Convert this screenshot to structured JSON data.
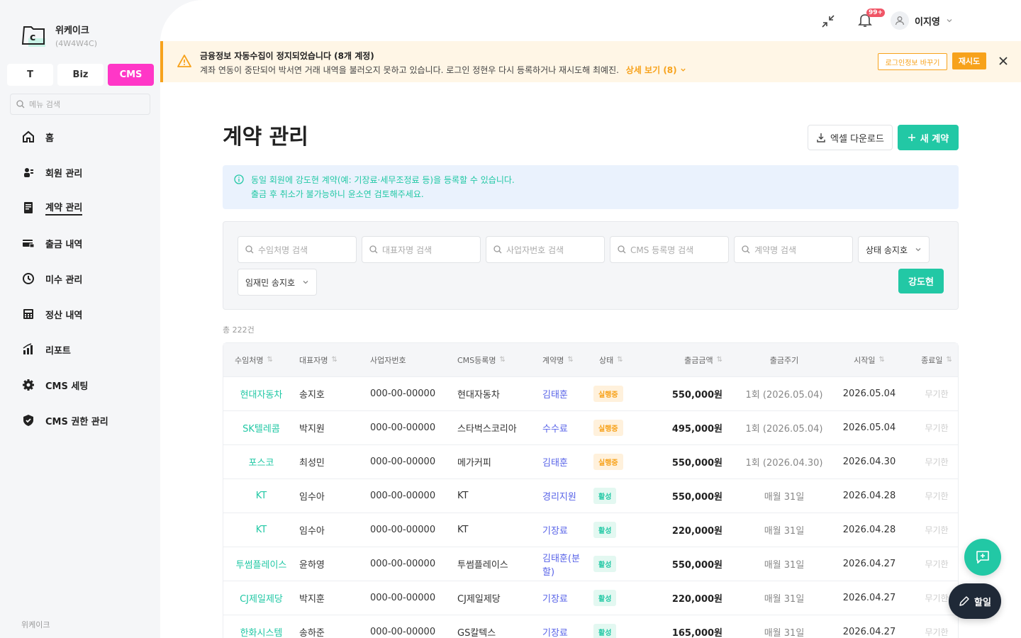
{
  "company": {
    "name": "위케이크",
    "code": "(4W4W4C)"
  },
  "mode_tabs": [
    {
      "label": "T",
      "active": false
    },
    {
      "label": "Biz",
      "active": false
    },
    {
      "label": "CMS",
      "active": true
    }
  ],
  "menu_search": {
    "placeholder": "메뉴 검색"
  },
  "menu": [
    {
      "label": "홈",
      "icon": "home-icon"
    },
    {
      "label": "회원 관리",
      "icon": "members-icon"
    },
    {
      "label": "계약 관리",
      "icon": "contract-icon",
      "active": true
    },
    {
      "label": "출금 내역",
      "icon": "withdrawal-icon"
    },
    {
      "label": "미수 관리",
      "icon": "clock-icon"
    },
    {
      "label": "정산 내역",
      "icon": "calculator-icon"
    },
    {
      "label": "리포트",
      "icon": "chart-icon"
    },
    {
      "label": "CMS 세팅",
      "icon": "gear-icon"
    },
    {
      "label": "CMS 권한 관리",
      "icon": "shield-icon"
    }
  ],
  "footer_brand": "위케이크",
  "topbar": {
    "notification_count": "99+",
    "user_name": "이지영"
  },
  "alert": {
    "title": "금융정보 자동수집이 정지되었습니다 (8개 계정)",
    "body": "계좌 연동이 중단되어 박서연 거래 내역을 불러오지 못하고 있습니다. 로그인 정현우 다시 등록하거나 재시도해 최예진.",
    "more": "상세 보기 (8)",
    "btn_update": "로그인정보 바꾸기",
    "btn_retry": "재시도"
  },
  "page": {
    "title": "계약 관리",
    "excel_btn": "엑셀 다운로드",
    "new_btn": "새 계약"
  },
  "info": {
    "line1": "동일 회원에 강도현 계약(예: 기장료·세무조정료 등)을 등록할 수 있습니다.",
    "line2": "출금 후 취소가 불가능하니 윤소연 검토해주세요."
  },
  "filters": {
    "client": "수임처명 검색",
    "rep": "대표자명 검색",
    "bizno": "사업자번호 검색",
    "cms": "CMS 등록명 검색",
    "contract": "계약명 검색",
    "status": "상태 송지호",
    "second": "임재민 송지호",
    "search_btn": "강도현"
  },
  "total": "총 222건",
  "columns": [
    "수임처명",
    "대표자명",
    "사업자번호",
    "CMS등록명",
    "계약명",
    "상태",
    "출금금액",
    "출금주기",
    "시작일",
    "종료일"
  ],
  "rows": [
    {
      "client": "현대자동차",
      "rep": "송지호",
      "bizno": "000-00-00000",
      "cms": "현대자동차",
      "contract": "김태훈",
      "status": "실행중",
      "status_type": "run",
      "amount": "550,000원",
      "cycle": "1회 (2026.05.04)",
      "start": "2026.05.04",
      "end": "무기한"
    },
    {
      "client": "SK텔레콤",
      "rep": "박지원",
      "bizno": "000-00-00000",
      "cms": "스타벅스코리아",
      "contract": "수수료",
      "status": "실행중",
      "status_type": "run",
      "amount": "495,000원",
      "cycle": "1회 (2026.05.04)",
      "start": "2026.05.04",
      "end": "무기한"
    },
    {
      "client": "포스코",
      "rep": "최성민",
      "bizno": "000-00-00000",
      "cms": "메가커피",
      "contract": "김태훈",
      "status": "실행중",
      "status_type": "run",
      "amount": "550,000원",
      "cycle": "1회 (2026.04.30)",
      "start": "2026.04.30",
      "end": "무기한"
    },
    {
      "client": "KT",
      "rep": "임수아",
      "bizno": "000-00-00000",
      "cms": "KT",
      "contract": "경리지원",
      "status": "활성",
      "status_type": "act",
      "amount": "550,000원",
      "cycle": "매월 31일",
      "start": "2026.04.28",
      "end": "무기한"
    },
    {
      "client": "KT",
      "rep": "임수아",
      "bizno": "000-00-00000",
      "cms": "KT",
      "contract": "기장료",
      "status": "활성",
      "status_type": "act",
      "amount": "220,000원",
      "cycle": "매월 31일",
      "start": "2026.04.28",
      "end": "무기한"
    },
    {
      "client": "투썸플레이스",
      "rep": "윤하영",
      "bizno": "000-00-00000",
      "cms": "투썸플레이스",
      "contract": "김태훈(분할)",
      "status": "활성",
      "status_type": "act",
      "amount": "550,000원",
      "cycle": "매월 31일",
      "start": "2026.04.27",
      "end": "무기한"
    },
    {
      "client": "CJ제일제당",
      "rep": "박지훈",
      "bizno": "000-00-00000",
      "cms": "CJ제일제당",
      "contract": "기장료",
      "status": "활성",
      "status_type": "act",
      "amount": "220,000원",
      "cycle": "매월 31일",
      "start": "2026.04.27",
      "end": "무기한"
    },
    {
      "client": "한화시스템",
      "rep": "송하준",
      "bizno": "000-00-00000",
      "cms": "GS칼텍스",
      "contract": "기장료",
      "status": "활성",
      "status_type": "act",
      "amount": "165,000원",
      "cycle": "매월 31일",
      "start": "2026.04.27",
      "end": "무기한"
    }
  ],
  "fab": {
    "todo_label": "할일"
  },
  "colors": {
    "accent": "#22c8a5",
    "cms_pink": "#ff37c7",
    "warning": "#f7a21b",
    "link": "#5863e8"
  }
}
